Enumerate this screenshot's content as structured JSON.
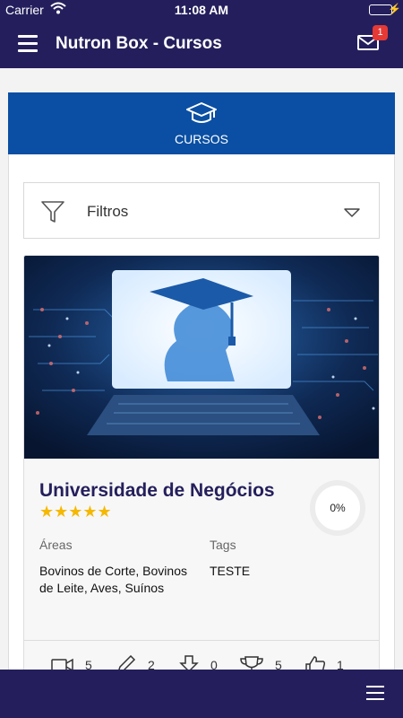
{
  "status_bar": {
    "carrier": "Carrier",
    "time": "11:08 AM",
    "wifi_icon": "wifi-icon",
    "battery_icon": "battery-charging-icon"
  },
  "app_bar": {
    "title": "Nutron Box - Cursos",
    "menu_icon": "hamburger-menu-icon",
    "mail_icon": "envelope-icon",
    "badge_count": "1"
  },
  "panel": {
    "header_label": "CURSOS",
    "header_icon": "graduation-cap-icon",
    "color": "#0a4fa3"
  },
  "filter": {
    "label": "Filtros",
    "icon": "funnel-icon",
    "toggle_icon": "chevron-down-icon"
  },
  "course": {
    "title": "Universidade de Negócios",
    "rating": 5,
    "stars_text": "★★★★★",
    "progress": "0%",
    "areas_label": "Áreas",
    "areas_value": "Bovinos de Corte, Bovinos de Leite, Aves, Suínos",
    "tags_label": "Tags",
    "tags_value": "TESTE",
    "stats": [
      {
        "icon": "video-camera-icon",
        "value": "5"
      },
      {
        "icon": "pencil-icon",
        "value": "2"
      },
      {
        "icon": "download-icon",
        "value": "0"
      },
      {
        "icon": "trophy-icon",
        "value": "5"
      },
      {
        "icon": "thumbs-up-icon",
        "value": "1"
      }
    ]
  },
  "bottom_bar": {
    "menu_icon": "hamburger-menu-icon"
  },
  "colors": {
    "brand_dark": "#241f5c",
    "brand_blue": "#0a4fa3",
    "star": "#f5b800",
    "badge": "#e53935"
  }
}
